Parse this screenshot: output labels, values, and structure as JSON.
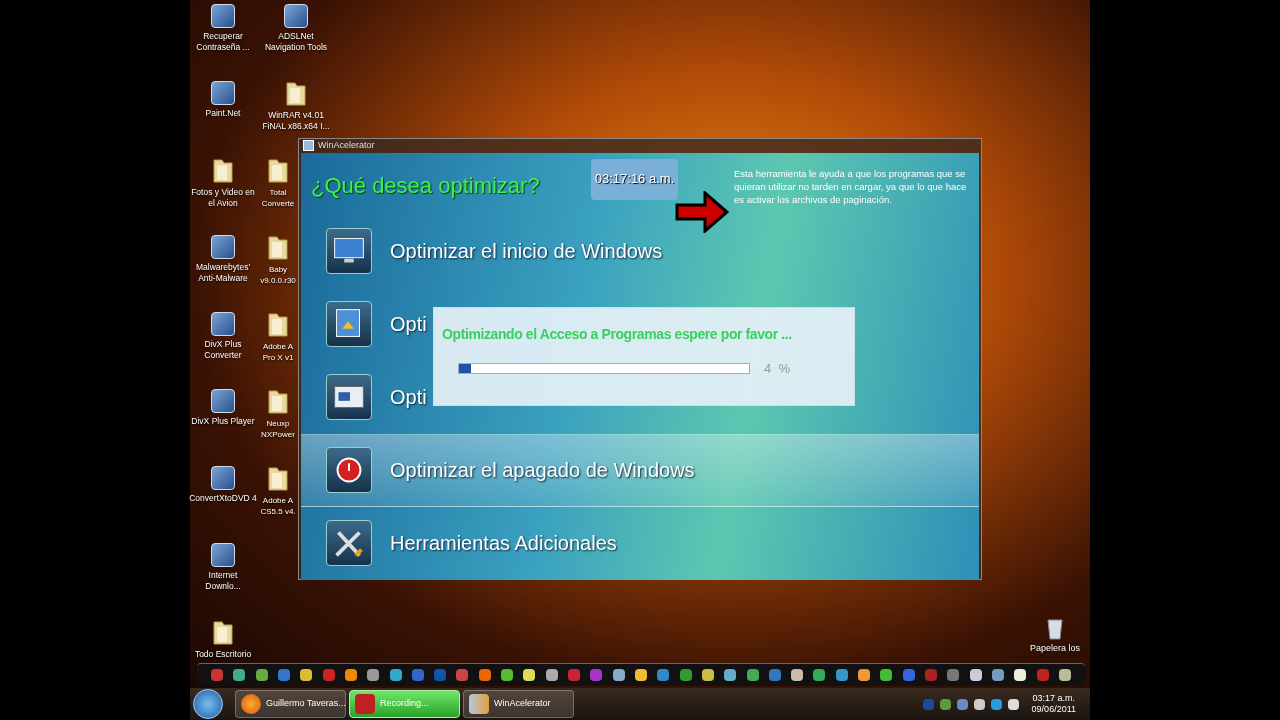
{
  "desktop_icons": {
    "left_column": [
      {
        "kind": "app",
        "lines": [
          "Recuperar",
          "Contraseña ..."
        ]
      },
      {
        "kind": "app",
        "lines": [
          "Paint.Net"
        ]
      },
      {
        "kind": "folder",
        "lines": [
          "Fotos y Video en",
          "el Avion"
        ]
      },
      {
        "kind": "app",
        "lines": [
          "Malwarebytes'",
          "Anti-Malware"
        ]
      },
      {
        "kind": "app",
        "lines": [
          "DivX Plus",
          "Converter"
        ]
      },
      {
        "kind": "app",
        "lines": [
          "DivX Plus Player"
        ]
      },
      {
        "kind": "app",
        "lines": [
          "ConvertXtoDVD 4"
        ]
      },
      {
        "kind": "app",
        "lines": [
          "Internet",
          "Downlo..."
        ]
      },
      {
        "kind": "folder",
        "lines": [
          "Todo Escritorio"
        ]
      }
    ],
    "right_column": [
      {
        "kind": "app",
        "lines": [
          "ADSLNet",
          "Navigation Tools"
        ]
      },
      {
        "kind": "folder",
        "lines": [
          "WinRAR v4.01",
          "FiNAL x86.x64 I..."
        ]
      },
      {
        "kind": "folder",
        "lines": [
          "Total",
          "Converte"
        ]
      },
      {
        "kind": "folder",
        "lines": [
          "Baby",
          "v9.0.0.r30"
        ]
      },
      {
        "kind": "folder",
        "lines": [
          "Adobe A",
          "Pro X v1"
        ]
      },
      {
        "kind": "folder",
        "lines": [
          "Neuxp",
          "NXPower"
        ]
      },
      {
        "kind": "folder",
        "lines": [
          "Adobe A",
          "CS5.5 v4."
        ]
      }
    ]
  },
  "recycle_bin": {
    "label": "Papelera los"
  },
  "window": {
    "title": "WinAcelerator",
    "heading": "¿Qué desea optimizar?",
    "clock": "03:17:16 a.m.",
    "description": "Esta herramienta le ayuda a que los programas que se quieran utilizar no tarden en cargar, ya que lo que hace es activar los archivos de paginación.",
    "menu_items": [
      {
        "kind": "monitor",
        "label": "Optimizar el inicio de Windows",
        "selected": false
      },
      {
        "kind": "install",
        "label": "Opti",
        "selected": false
      },
      {
        "kind": "programs",
        "label": "Opti",
        "selected": false
      },
      {
        "kind": "power",
        "label": "Optimizar el apagado de Windows",
        "selected": true
      },
      {
        "kind": "tools",
        "label": "Herramientas Adicionales",
        "selected": false
      }
    ]
  },
  "progress_dialog": {
    "message": "Optimizando el Acceso a Programas espere por favor ...",
    "level": 0.04,
    "reading": "4  %"
  },
  "taskbar": {
    "tasks": [
      {
        "kind": "browser",
        "label": "Guillermo Taveras...",
        "flashing": false
      },
      {
        "kind": "recorder",
        "label": "Recording...",
        "flashing": true
      },
      {
        "kind": "app",
        "label": "WinAcelerator",
        "flashing": false
      }
    ],
    "time": "03:17 a.m.",
    "date": "09/06/2011"
  }
}
